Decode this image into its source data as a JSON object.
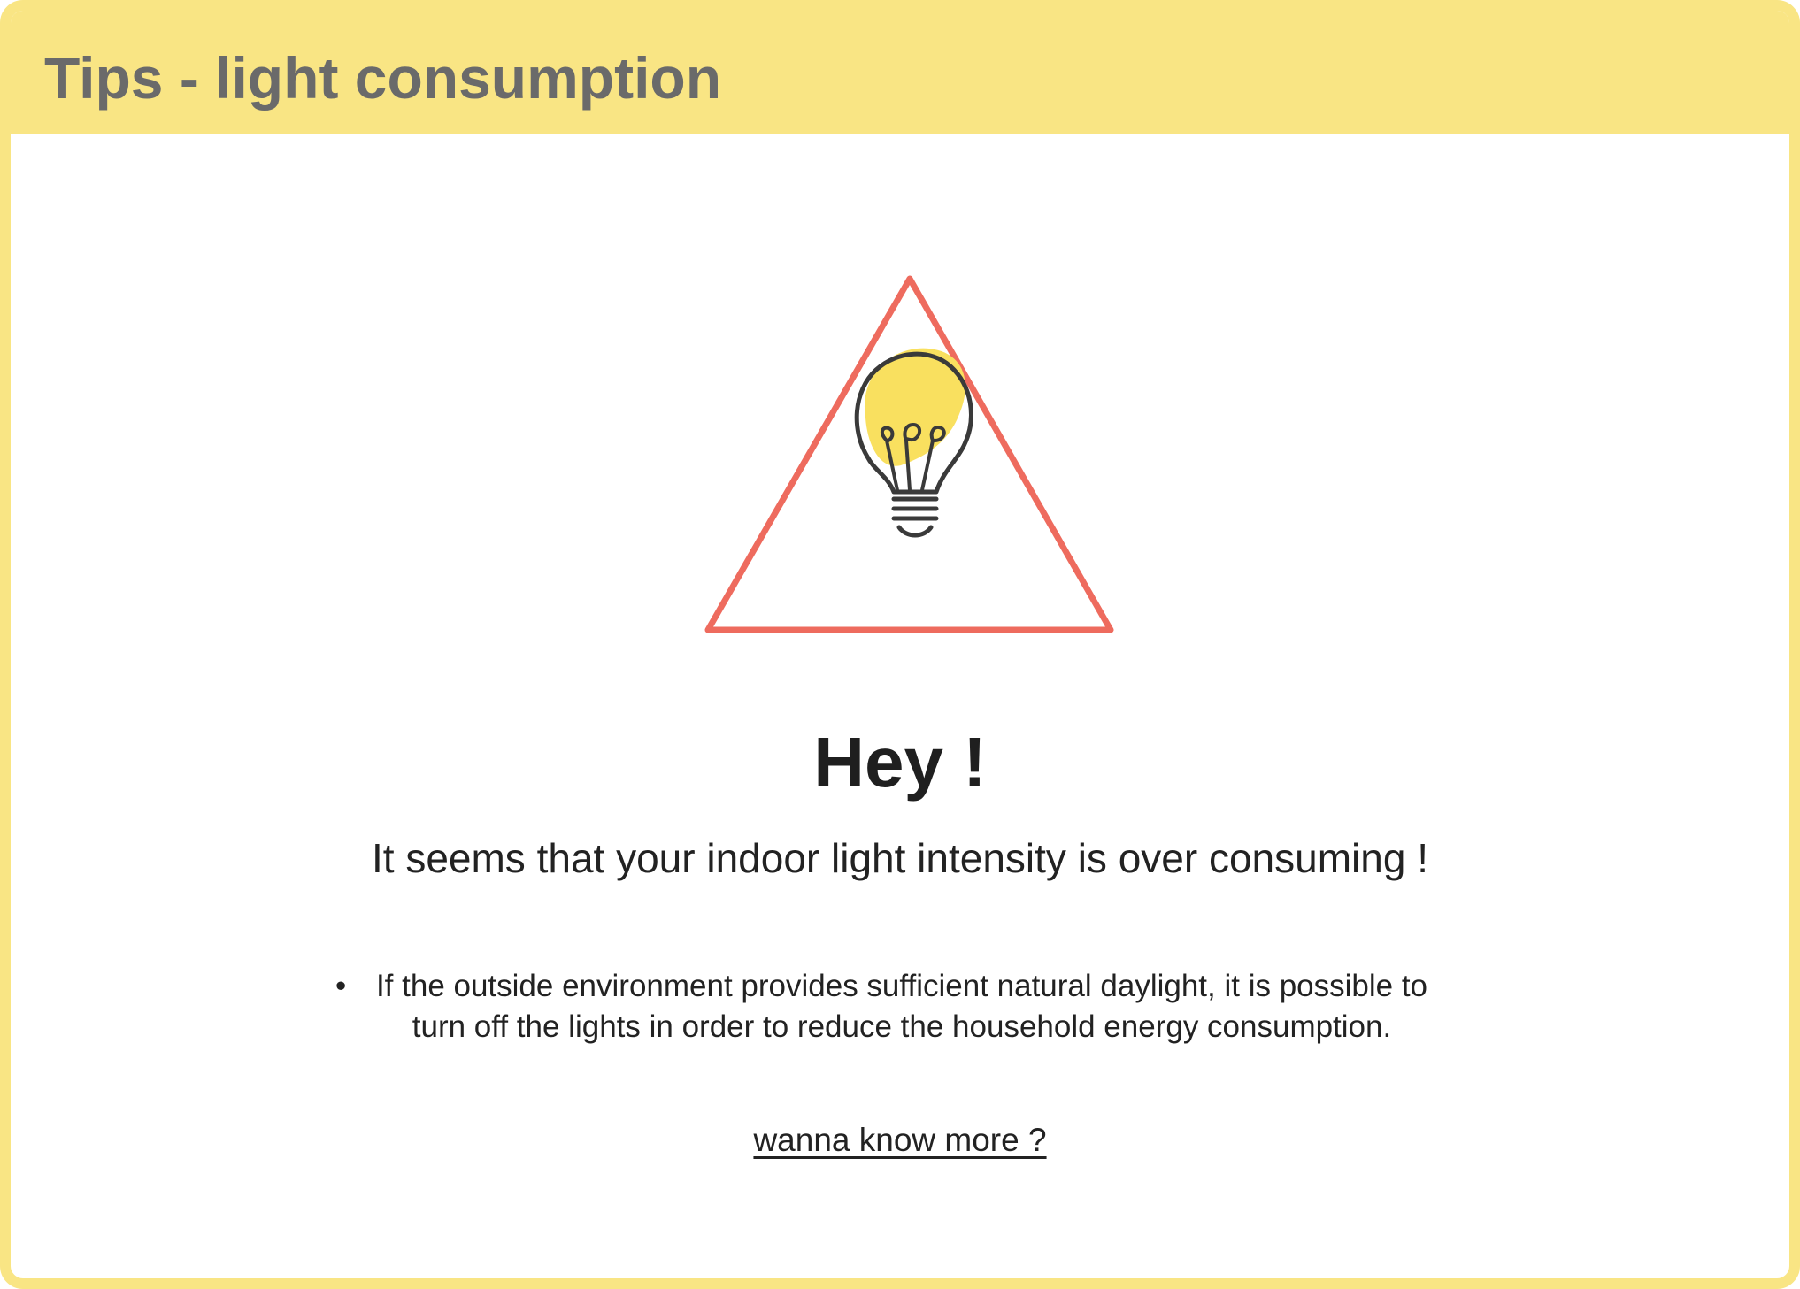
{
  "header": {
    "title": "Tips - light consumption"
  },
  "alert": {
    "icon": "warning-triangle-icon",
    "inner_icon": "lightbulb-icon",
    "heading": "Hey !",
    "message": "It seems that your indoor light intensity is over consuming !"
  },
  "tips": [
    {
      "bullet": "•",
      "text": "If the outside environment provides sufficient natural daylight, it is possible to turn off the lights in order to reduce the household energy consumption."
    }
  ],
  "link": {
    "label": "wanna know more ?"
  },
  "colors": {
    "accent_yellow": "#F9E584",
    "warning_red": "#EE6B5E",
    "title_gray": "#6A6A6A",
    "text_dark": "#222222"
  }
}
